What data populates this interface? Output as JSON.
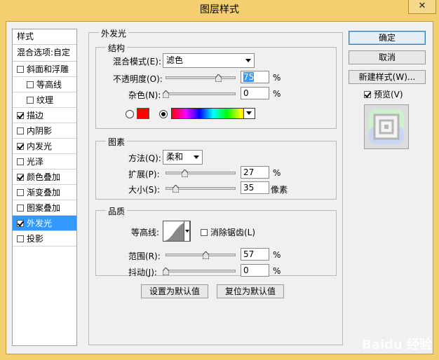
{
  "window": {
    "title": "图层样式",
    "close_label": "✕"
  },
  "style_list": {
    "header": "样式",
    "blend_options": "混合选项:自定",
    "items": [
      {
        "label": "斜面和浮雕",
        "checked": false,
        "indent": false,
        "selected": false
      },
      {
        "label": "等高线",
        "checked": false,
        "indent": true,
        "selected": false
      },
      {
        "label": "纹理",
        "checked": false,
        "indent": true,
        "selected": false
      },
      {
        "label": "描边",
        "checked": true,
        "indent": false,
        "selected": false
      },
      {
        "label": "内阴影",
        "checked": false,
        "indent": false,
        "selected": false
      },
      {
        "label": "内发光",
        "checked": true,
        "indent": false,
        "selected": false
      },
      {
        "label": "光泽",
        "checked": false,
        "indent": false,
        "selected": false
      },
      {
        "label": "颜色叠加",
        "checked": true,
        "indent": false,
        "selected": false
      },
      {
        "label": "渐变叠加",
        "checked": false,
        "indent": false,
        "selected": false
      },
      {
        "label": "图案叠加",
        "checked": false,
        "indent": false,
        "selected": false
      },
      {
        "label": "外发光",
        "checked": true,
        "indent": false,
        "selected": true
      },
      {
        "label": "投影",
        "checked": false,
        "indent": false,
        "selected": false
      }
    ]
  },
  "panel": {
    "title": "外发光",
    "structure": {
      "title": "结构",
      "blend_mode_label": "混合模式(E):",
      "blend_mode_value": "滤色",
      "opacity_label": "不透明度(O):",
      "opacity_value": "75",
      "opacity_percent": 75,
      "opacity_unit": "%",
      "noise_label": "杂色(N):",
      "noise_value": "0",
      "noise_percent": 0,
      "noise_unit": "%",
      "color_mode": "solid",
      "solid_color": "#ff0000"
    },
    "elements": {
      "title": "图素",
      "method_label": "方法(Q):",
      "method_value": "柔和",
      "spread_label": "扩展(P):",
      "spread_value": "27",
      "spread_percent": 27,
      "spread_unit": "%",
      "size_label": "大小(S):",
      "size_value": "35",
      "size_fraction": 0.14,
      "size_unit": "像素"
    },
    "quality": {
      "title": "品质",
      "contour_label": "等高线:",
      "antialias_label": "消除锯齿(L)",
      "antialias_checked": false,
      "range_label": "范围(R):",
      "range_value": "57",
      "range_percent": 57,
      "range_unit": "%",
      "jitter_label": "抖动(J):",
      "jitter_value": "0",
      "jitter_percent": 0,
      "jitter_unit": "%"
    },
    "make_default": "设置为默认值",
    "reset_default": "复位为默认值"
  },
  "buttons": {
    "ok": "确定",
    "cancel": "取消",
    "new_style": "新建样式(W)...",
    "preview_label": "预览(V)",
    "preview_checked": true
  },
  "watermark": "Baidu 经验"
}
